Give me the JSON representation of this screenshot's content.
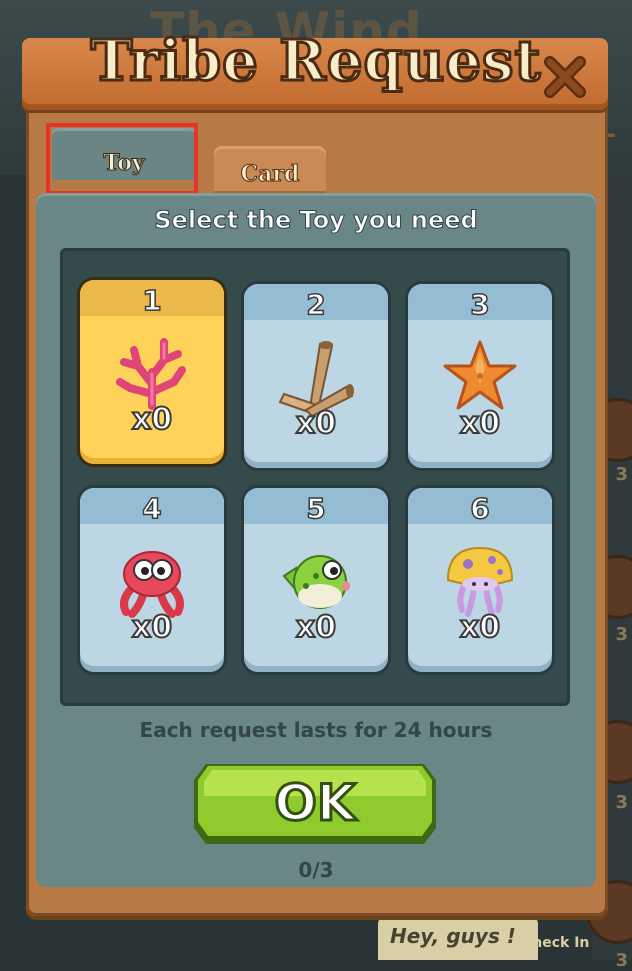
{
  "background": {
    "title_fragment": "The Wind",
    "plus_symbol": "+",
    "side_counts": [
      "3",
      "3",
      "3",
      "3"
    ],
    "chat_bubble": "Hey, guys !",
    "chat_bubble_partial": "Check In"
  },
  "dialog": {
    "title": "Tribe Request",
    "tabs": [
      {
        "label": "Toy",
        "active": true
      },
      {
        "label": "Card",
        "active": false
      }
    ],
    "instruction": "Select the Toy you need",
    "toys": [
      {
        "number": "1",
        "count": "x0",
        "icon": "coral-icon",
        "selected": true
      },
      {
        "number": "2",
        "count": "x0",
        "icon": "seashell-icon",
        "selected": false
      },
      {
        "number": "3",
        "count": "x0",
        "icon": "starfish-icon",
        "selected": false
      },
      {
        "number": "4",
        "count": "x0",
        "icon": "octopus-icon",
        "selected": false
      },
      {
        "number": "5",
        "count": "x0",
        "icon": "pufferfish-icon",
        "selected": false
      },
      {
        "number": "6",
        "count": "x0",
        "icon": "jellyfish-icon",
        "selected": false
      }
    ],
    "note": "Each request lasts for 24 hours",
    "ok_label": "OK",
    "progress": "0/3"
  },
  "colors": {
    "wood": "#c06a2e",
    "panel": "#6b8687",
    "card_blue": "#bcd6e4",
    "card_selected": "#ffd35a",
    "ok_green": "#8fcb2c",
    "tab_highlight": "#e8322c"
  }
}
